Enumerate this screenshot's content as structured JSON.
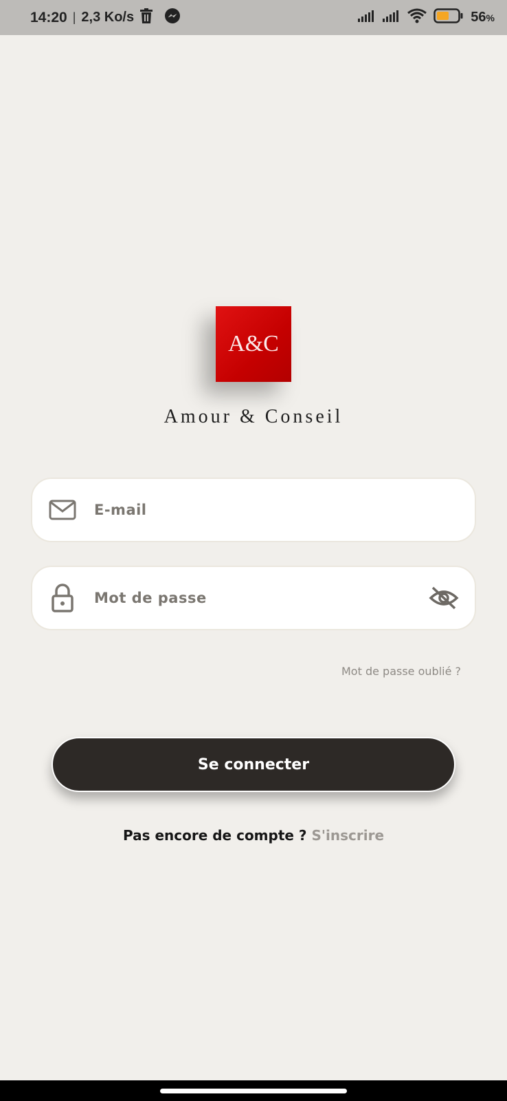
{
  "status_bar": {
    "time": "14:20",
    "separator": "|",
    "network_speed": "2,3 Ko/s",
    "battery_percent": "56",
    "battery_unit": "%",
    "battery_level": 0.56
  },
  "brand": {
    "logo_text": "A&C",
    "name": "Amour & Conseil",
    "logo_color": "#d40808"
  },
  "form": {
    "email": {
      "placeholder": "E-mail",
      "value": ""
    },
    "password": {
      "placeholder": "Mot de passe",
      "value": ""
    },
    "forgot_password": "Mot de passe oublié ?",
    "submit_label": "Se connecter"
  },
  "signup": {
    "prompt": "Pas encore de compte ? ",
    "link": "S'inscrire"
  },
  "icons": {
    "email": "mail-icon",
    "password": "lock-icon",
    "toggle": "eye-off-icon"
  },
  "colors": {
    "background": "#f1efeb",
    "button": "#2d2926",
    "battery_accent": "#f5a623"
  }
}
